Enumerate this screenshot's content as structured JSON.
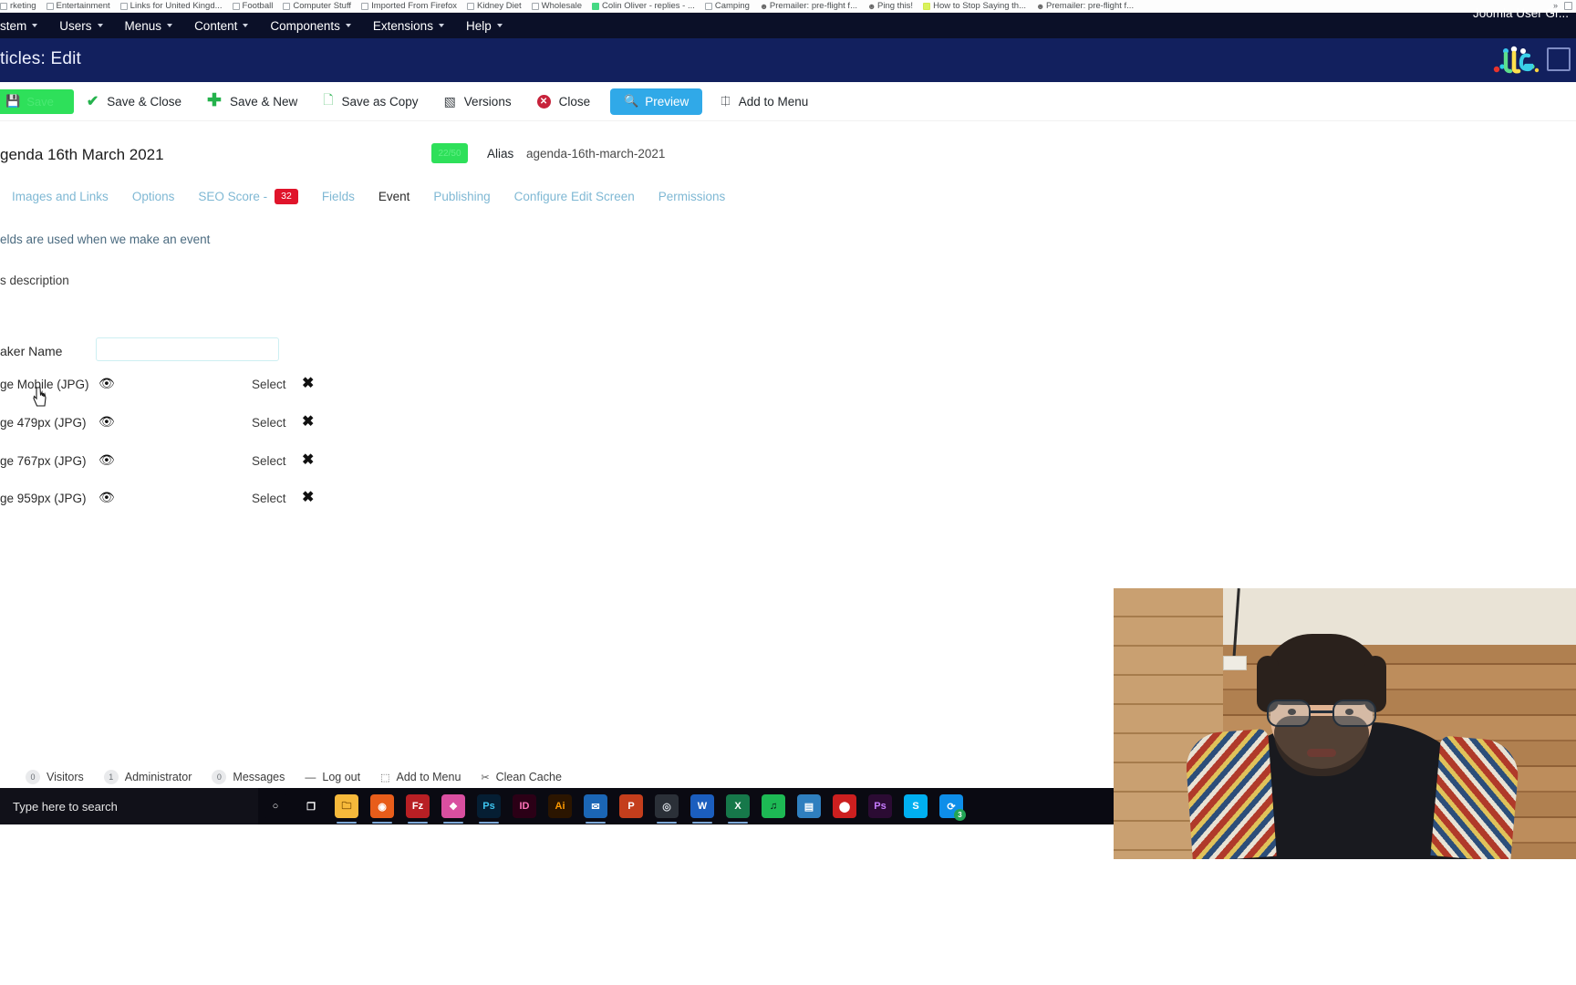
{
  "browser": {
    "bookmarks": [
      {
        "label": "rketing",
        "icon": "bookmark-folder-icon",
        "style": "box"
      },
      {
        "label": "Entertainment",
        "icon": "bookmark-folder-icon",
        "style": "box"
      },
      {
        "label": "Links for United Kingd...",
        "icon": "bookmark-folder-icon",
        "style": "box"
      },
      {
        "label": "Football",
        "icon": "bookmark-folder-icon",
        "style": "box"
      },
      {
        "label": "Computer Stuff",
        "icon": "bookmark-folder-icon",
        "style": "box"
      },
      {
        "label": "Imported From Firefox",
        "icon": "bookmark-folder-icon",
        "style": "box"
      },
      {
        "label": "Kidney Diet",
        "icon": "bookmark-folder-icon",
        "style": "box"
      },
      {
        "label": "Wholesale",
        "icon": "bookmark-folder-icon",
        "style": "box"
      },
      {
        "label": "Colin Oliver - replies - ...",
        "icon": "favicon-green",
        "style": "green"
      },
      {
        "label": "Camping",
        "icon": "bookmark-folder-icon",
        "style": "box"
      },
      {
        "label": "Premailer: pre-flight f...",
        "icon": "favicon-face",
        "style": "face"
      },
      {
        "label": "Ping this!",
        "icon": "favicon-face",
        "style": "face"
      },
      {
        "label": "How to Stop Saying th...",
        "icon": "favicon-lime",
        "style": "lime"
      },
      {
        "label": "Premailer: pre-flight f...",
        "icon": "favicon-face",
        "style": "face"
      }
    ],
    "overflow_label": "»"
  },
  "admin_menu": {
    "items": [
      {
        "label": "stem",
        "has_caret": true,
        "name": "menu-system"
      },
      {
        "label": "Users",
        "has_caret": true,
        "name": "menu-users"
      },
      {
        "label": "Menus",
        "has_caret": true,
        "name": "menu-menus"
      },
      {
        "label": "Content",
        "has_caret": true,
        "name": "menu-content"
      },
      {
        "label": "Components",
        "has_caret": true,
        "name": "menu-components"
      },
      {
        "label": "Extensions",
        "has_caret": true,
        "name": "menu-extensions"
      },
      {
        "label": "Help",
        "has_caret": true,
        "name": "menu-help"
      }
    ],
    "site_name": "Joomla User Gr..."
  },
  "header": {
    "page_title": "ticles: Edit",
    "logo_text": ".JUG."
  },
  "toolbar": {
    "save_label": "Save",
    "save_close_label": "Save & Close",
    "save_new_label": "Save & New",
    "save_copy_label": "Save as Copy",
    "versions_label": "Versions",
    "close_label": "Close",
    "preview_label": "Preview",
    "add_to_menu_label": "Add to Menu"
  },
  "article": {
    "title": "genda 16th March 2021",
    "char_counter": "22/50",
    "alias_label": "Alias",
    "alias_value": "agenda-16th-march-2021"
  },
  "tabs": [
    {
      "label": "Images and Links",
      "active": false,
      "name": "tab-images-and-links"
    },
    {
      "label": "Options",
      "active": false,
      "name": "tab-options"
    },
    {
      "label": "SEO Score -",
      "active": false,
      "name": "tab-seo-score",
      "badge": "32"
    },
    {
      "label": "Fields",
      "active": false,
      "name": "tab-fields"
    },
    {
      "label": "Event",
      "active": true,
      "name": "tab-event"
    },
    {
      "label": "Publishing",
      "active": false,
      "name": "tab-publishing"
    },
    {
      "label": "Configure Edit Screen",
      "active": false,
      "name": "tab-configure-edit-screen"
    },
    {
      "label": "Permissions",
      "active": false,
      "name": "tab-permissions"
    }
  ],
  "form": {
    "hint_text": "elds are used when we make an event",
    "description_label": "s description",
    "speaker_label": "aker Name",
    "speaker_value": "",
    "speaker_placeholder": "",
    "image_rows": [
      {
        "label": "ge Mobile (JPG)",
        "eye": "👁",
        "select": "Select",
        "clear": "✖"
      },
      {
        "label": "ge 479px (JPG)",
        "eye": "👁",
        "select": "Select",
        "clear": "✖"
      },
      {
        "label": "ge 767px (JPG)",
        "eye": "👁",
        "select": "Select",
        "clear": "✖"
      },
      {
        "label": "ge 959px (JPG)",
        "eye": "👁",
        "select": "Select",
        "clear": "✖"
      }
    ]
  },
  "status_bar": {
    "leader": "·",
    "items": [
      {
        "label": "Visitors",
        "count": "0",
        "name": "status-visitors"
      },
      {
        "label": "Administrator",
        "count": "1",
        "name": "status-administrator"
      },
      {
        "label": "Messages",
        "count": "0",
        "name": "status-messages"
      },
      {
        "label": "Log out",
        "count": "—",
        "name": "status-log-out"
      },
      {
        "label": "Add to Menu",
        "count": "",
        "name": "status-add-to-menu"
      },
      {
        "label": "Clean Cache",
        "count": "",
        "name": "status-clean-cache"
      }
    ]
  },
  "taskbar": {
    "search_placeholder": "Type here to search",
    "apps": [
      {
        "name": "cortana-icon",
        "glyph": "○",
        "color": "#0a0a12",
        "fg": "#ffffff",
        "open": false
      },
      {
        "name": "task-view-icon",
        "glyph": "❐",
        "color": "#0a0a12",
        "fg": "#ffffff",
        "open": false
      },
      {
        "name": "file-explorer-icon",
        "glyph": "🗀",
        "color": "#f6b93b",
        "fg": "#7a4b00",
        "open": true
      },
      {
        "name": "firefox-icon",
        "glyph": "◉",
        "color": "#e85d1a",
        "fg": "#ffffff",
        "open": true
      },
      {
        "name": "filezilla-icon",
        "glyph": "Fz",
        "color": "#b81f24",
        "fg": "#ffffff",
        "open": true
      },
      {
        "name": "photos-icon",
        "glyph": "❖",
        "color": "#d94fa0",
        "fg": "#ffffff",
        "open": true
      },
      {
        "name": "photoshop-icon",
        "glyph": "Ps",
        "color": "#051e33",
        "fg": "#3dc5f0",
        "open": true
      },
      {
        "name": "indesign-icon",
        "glyph": "ID",
        "color": "#2b0016",
        "fg": "#ff73b8",
        "open": false
      },
      {
        "name": "illustrator-icon",
        "glyph": "Ai",
        "color": "#2b1500",
        "fg": "#ff9a00",
        "open": false
      },
      {
        "name": "outlook-icon",
        "glyph": "✉",
        "color": "#1b66b5",
        "fg": "#ffffff",
        "open": true
      },
      {
        "name": "powerpoint-icon",
        "glyph": "P",
        "color": "#c43e1c",
        "fg": "#ffffff",
        "open": false
      },
      {
        "name": "obs-icon",
        "glyph": "◎",
        "color": "#2b3038",
        "fg": "#d6dbe1",
        "open": true
      },
      {
        "name": "word-icon",
        "glyph": "W",
        "color": "#1b5ebe",
        "fg": "#ffffff",
        "open": true
      },
      {
        "name": "excel-icon",
        "glyph": "X",
        "color": "#16784a",
        "fg": "#ffffff",
        "open": true
      },
      {
        "name": "spotify-icon",
        "glyph": "♫",
        "color": "#1db954",
        "fg": "#0a0a12",
        "open": false
      },
      {
        "name": "store-icon",
        "glyph": "▤",
        "color": "#2f7fbf",
        "fg": "#ffffff",
        "open": false
      },
      {
        "name": "acrobat-icon",
        "glyph": "⬤",
        "color": "#cc1f1f",
        "fg": "#ffffff",
        "open": false
      },
      {
        "name": "photoshop-express-icon",
        "glyph": "Ps",
        "color": "#2b0b33",
        "fg": "#c77bff",
        "open": false
      },
      {
        "name": "skype-icon",
        "glyph": "S",
        "color": "#00aff0",
        "fg": "#ffffff",
        "open": false
      },
      {
        "name": "teamviewer-icon",
        "glyph": "⟳",
        "color": "#0e8ee9",
        "fg": "#ffffff",
        "open": false,
        "badge": "3"
      }
    ]
  }
}
